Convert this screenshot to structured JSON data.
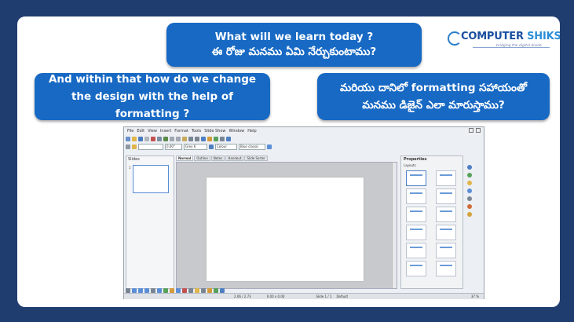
{
  "slide": {
    "question_en": "What will we learn today ?",
    "question_te": "ఈ రోజు మనము ఏమి నేర్చుకుంటాము?",
    "left_text": "And within that how do we change the design with the help of formatting ?",
    "right_line1": "మరియు దానిలో formatting సహాయంతో",
    "right_line2": "మనము డిజైన్ ఎలా మారుస్తాము?"
  },
  "logo": {
    "name_part1": "COMPUTER ",
    "name_part2": "SHIKSHA",
    "tagline": "bridging the digital divide"
  },
  "app": {
    "menu": [
      "File",
      "Edit",
      "View",
      "Insert",
      "Format",
      "Tools",
      "Slide Show",
      "Window",
      "Help"
    ],
    "font_name": "Colour",
    "color_name": "Blue classic",
    "size_field": "0.00\"",
    "line_field": "Grey 6",
    "slides_pane_title": "Slides",
    "slide_number": "1",
    "view_tabs": [
      "Normal",
      "Outline",
      "Notes",
      "Handout",
      "Slide Sorter"
    ],
    "properties_title": "Properties",
    "layouts_label": "Layouts",
    "status_position": "2.06 / 2.73",
    "status_size": "0.00 x 0.00",
    "status_slide": "Slide 1 / 1",
    "status_master": "Default",
    "status_zoom": "37 %"
  },
  "colors": {
    "background": "#203d70",
    "bubble": "#1769c4",
    "logo_dark": "#1a4fa0",
    "logo_light": "#2b8ed8"
  }
}
